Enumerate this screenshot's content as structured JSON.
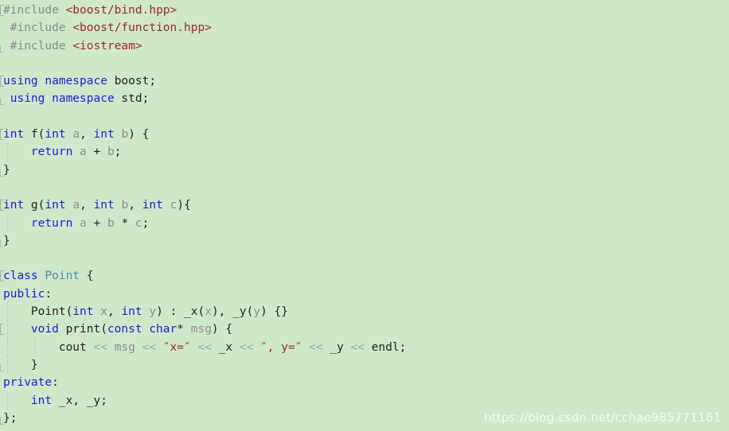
{
  "editor": {
    "language": "C++",
    "background_color": "#cfe8ca",
    "colors": {
      "preprocessor": "#8a8a8a",
      "header_path": "#9e2a2a",
      "keyword": "#1d1dd6",
      "class_name": "#4a8fa8",
      "identifier": "#8e8e8e",
      "plain": "#24221f",
      "string": "#9e2a2a",
      "stream_operator": "#7fb0a8",
      "indent_guide": "#d8b8c4",
      "fold_marker": "#9a9a9a"
    }
  },
  "watermark": {
    "text": "https://blog.csdn.net/cchao985771161"
  },
  "code": {
    "lines": [
      {
        "id": 1,
        "fold": "start",
        "guides": [],
        "tokens": [
          {
            "cls": "t-pre",
            "text": "#include "
          },
          {
            "cls": "t-header",
            "text": "<boost/bind.hpp>"
          }
        ]
      },
      {
        "id": 2,
        "fold": "none",
        "guides": [],
        "tokens": [
          {
            "cls": "t-pre",
            "text": " #include "
          },
          {
            "cls": "t-header",
            "text": "<boost/function.hpp>"
          }
        ]
      },
      {
        "id": 3,
        "fold": "end",
        "guides": [],
        "tokens": [
          {
            "cls": "t-pre",
            "text": " #include "
          },
          {
            "cls": "t-header",
            "text": "<iostream>"
          }
        ]
      },
      {
        "id": 4,
        "fold": "none",
        "guides": [],
        "tokens": []
      },
      {
        "id": 5,
        "fold": "start",
        "guides": [],
        "tokens": [
          {
            "cls": "t-kw",
            "text": "using namespace "
          },
          {
            "cls": "t-plain",
            "text": "boost;"
          }
        ]
      },
      {
        "id": 6,
        "fold": "end",
        "guides": [],
        "tokens": [
          {
            "cls": "t-kw",
            "text": " using namespace "
          },
          {
            "cls": "t-plain",
            "text": "std;"
          }
        ]
      },
      {
        "id": 7,
        "fold": "none",
        "guides": [],
        "tokens": []
      },
      {
        "id": 8,
        "fold": "start",
        "guides": [],
        "tokens": [
          {
            "cls": "t-kw",
            "text": "int"
          },
          {
            "cls": "t-plain",
            "text": " f("
          },
          {
            "cls": "t-kw",
            "text": "int"
          },
          {
            "cls": "t-id",
            "text": " a"
          },
          {
            "cls": "t-plain",
            "text": ", "
          },
          {
            "cls": "t-kw",
            "text": "int"
          },
          {
            "cls": "t-id",
            "text": " b"
          },
          {
            "cls": "t-plain",
            "text": ") {"
          }
        ]
      },
      {
        "id": 9,
        "fold": "none",
        "guides": [
          "g1"
        ],
        "tokens": [
          {
            "cls": "t-kw",
            "text": "    return"
          },
          {
            "cls": "t-id",
            "text": " a "
          },
          {
            "cls": "t-plain",
            "text": "+"
          },
          {
            "cls": "t-id",
            "text": " b"
          },
          {
            "cls": "t-plain",
            "text": ";"
          }
        ]
      },
      {
        "id": 10,
        "fold": "end",
        "guides": [],
        "tokens": [
          {
            "cls": "t-plain",
            "text": "}"
          }
        ]
      },
      {
        "id": 11,
        "fold": "none",
        "guides": [],
        "tokens": []
      },
      {
        "id": 12,
        "fold": "start",
        "guides": [],
        "tokens": [
          {
            "cls": "t-kw",
            "text": "int"
          },
          {
            "cls": "t-plain",
            "text": " g("
          },
          {
            "cls": "t-kw",
            "text": "int"
          },
          {
            "cls": "t-id",
            "text": " a"
          },
          {
            "cls": "t-plain",
            "text": ", "
          },
          {
            "cls": "t-kw",
            "text": "int"
          },
          {
            "cls": "t-id",
            "text": " b"
          },
          {
            "cls": "t-plain",
            "text": ", "
          },
          {
            "cls": "t-kw",
            "text": "int"
          },
          {
            "cls": "t-id",
            "text": " c"
          },
          {
            "cls": "t-plain",
            "text": "){"
          }
        ]
      },
      {
        "id": 13,
        "fold": "none",
        "guides": [
          "g1"
        ],
        "tokens": [
          {
            "cls": "t-kw",
            "text": "    return"
          },
          {
            "cls": "t-id",
            "text": " a "
          },
          {
            "cls": "t-plain",
            "text": "+"
          },
          {
            "cls": "t-id",
            "text": " b "
          },
          {
            "cls": "t-plain",
            "text": "*"
          },
          {
            "cls": "t-id",
            "text": " c"
          },
          {
            "cls": "t-plain",
            "text": ";"
          }
        ]
      },
      {
        "id": 14,
        "fold": "end",
        "guides": [],
        "tokens": [
          {
            "cls": "t-plain",
            "text": "}"
          }
        ]
      },
      {
        "id": 15,
        "fold": "none",
        "guides": [],
        "tokens": []
      },
      {
        "id": 16,
        "fold": "start",
        "guides": [],
        "tokens": [
          {
            "cls": "t-kw",
            "text": "class"
          },
          {
            "cls": "t-type",
            "text": " Point"
          },
          {
            "cls": "t-plain",
            "text": " {"
          }
        ]
      },
      {
        "id": 17,
        "fold": "none",
        "guides": [],
        "tokens": [
          {
            "cls": "t-kw",
            "text": "public"
          },
          {
            "cls": "t-plain",
            "text": ":"
          }
        ]
      },
      {
        "id": 18,
        "fold": "none",
        "guides": [
          "g1"
        ],
        "tokens": [
          {
            "cls": "t-plain",
            "text": "    Point("
          },
          {
            "cls": "t-kw",
            "text": "int"
          },
          {
            "cls": "t-id",
            "text": " x"
          },
          {
            "cls": "t-plain",
            "text": ", "
          },
          {
            "cls": "t-kw",
            "text": "int"
          },
          {
            "cls": "t-id",
            "text": " y"
          },
          {
            "cls": "t-plain",
            "text": ") : _x("
          },
          {
            "cls": "t-id",
            "text": "x"
          },
          {
            "cls": "t-plain",
            "text": "), _y("
          },
          {
            "cls": "t-id",
            "text": "y"
          },
          {
            "cls": "t-plain",
            "text": ") {}"
          }
        ]
      },
      {
        "id": 19,
        "fold": "start",
        "guides": [
          "g1"
        ],
        "tokens": [
          {
            "cls": "t-kw",
            "text": "    void"
          },
          {
            "cls": "t-plain",
            "text": " print("
          },
          {
            "cls": "t-kw",
            "text": "const char"
          },
          {
            "cls": "t-plain",
            "text": "*"
          },
          {
            "cls": "t-id",
            "text": " msg"
          },
          {
            "cls": "t-plain",
            "text": ") {"
          }
        ]
      },
      {
        "id": 20,
        "fold": "none",
        "guides": [
          "g1",
          "g2"
        ],
        "tokens": [
          {
            "cls": "t-plain",
            "text": "        cout "
          },
          {
            "cls": "t-op",
            "text": "<<"
          },
          {
            "cls": "t-id",
            "text": " msg "
          },
          {
            "cls": "t-op",
            "text": "<<"
          },
          {
            "cls": "t-str",
            "text": " ″x=″ "
          },
          {
            "cls": "t-op",
            "text": "<<"
          },
          {
            "cls": "t-plain",
            "text": " _x "
          },
          {
            "cls": "t-op",
            "text": "<<"
          },
          {
            "cls": "t-str",
            "text": " ″, y=″ "
          },
          {
            "cls": "t-op",
            "text": "<<"
          },
          {
            "cls": "t-plain",
            "text": " _y "
          },
          {
            "cls": "t-op",
            "text": "<<"
          },
          {
            "cls": "t-plain",
            "text": " endl;"
          }
        ]
      },
      {
        "id": 21,
        "fold": "end",
        "guides": [
          "g1"
        ],
        "tokens": [
          {
            "cls": "t-plain",
            "text": "    }"
          }
        ]
      },
      {
        "id": 22,
        "fold": "none",
        "guides": [],
        "tokens": [
          {
            "cls": "t-kw",
            "text": "private"
          },
          {
            "cls": "t-plain",
            "text": ":"
          }
        ]
      },
      {
        "id": 23,
        "fold": "none",
        "guides": [
          "g1"
        ],
        "tokens": [
          {
            "cls": "t-kw",
            "text": "    int"
          },
          {
            "cls": "t-plain",
            "text": " _x, _y;"
          }
        ]
      },
      {
        "id": 24,
        "fold": "end",
        "guides": [],
        "tokens": [
          {
            "cls": "t-plain",
            "text": "};"
          }
        ]
      }
    ]
  }
}
